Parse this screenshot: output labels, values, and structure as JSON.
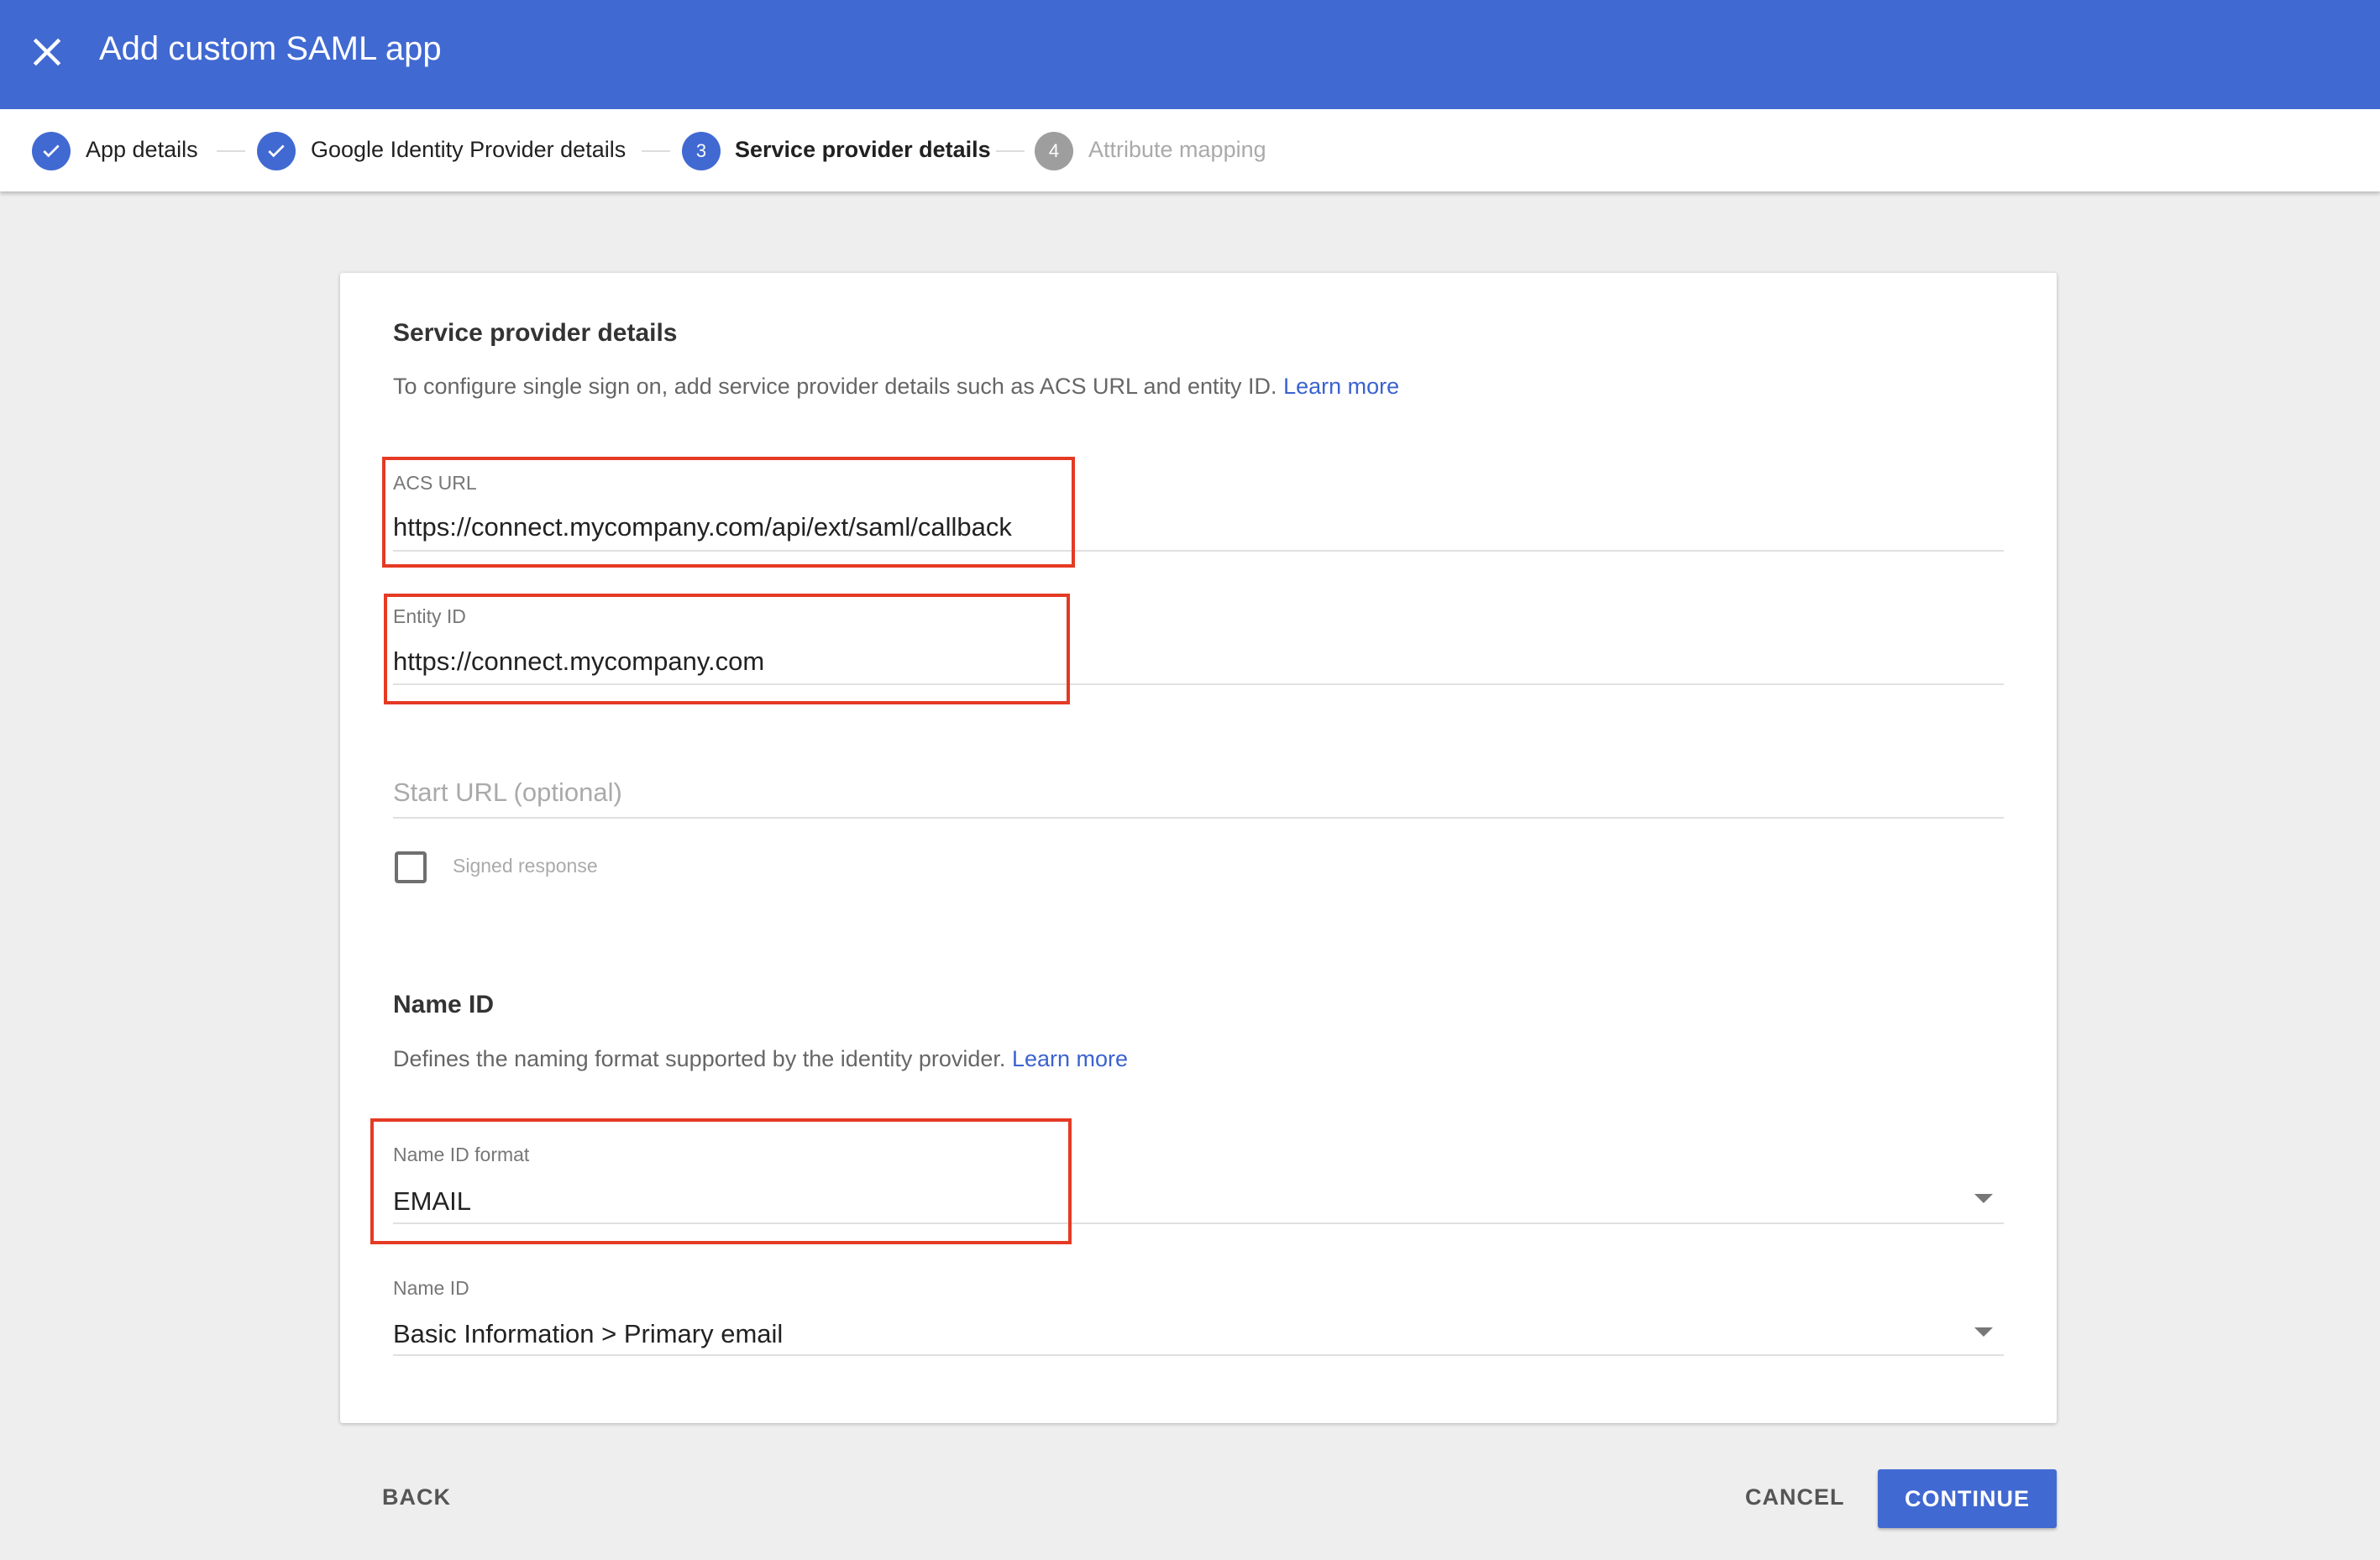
{
  "header": {
    "title": "Add custom SAML app"
  },
  "stepper": [
    {
      "label": "App details",
      "state": "done"
    },
    {
      "label": "Google Identity Provider details",
      "state": "done"
    },
    {
      "label": "Service provider details",
      "number": "3",
      "state": "active"
    },
    {
      "label": "Attribute mapping",
      "number": "4",
      "state": "pending"
    }
  ],
  "service": {
    "title": "Service provider details",
    "description": "To configure single sign on, add service provider details such as ACS URL and entity ID.",
    "learn_more": "Learn more",
    "acs_label": "ACS URL",
    "acs_value": "https://connect.mycompany.com/api/ext/saml/callback",
    "entity_label": "Entity ID",
    "entity_value": "https://connect.mycompany.com",
    "start_url_placeholder": "Start URL (optional)",
    "signed_response": "Signed response"
  },
  "nameid": {
    "title": "Name ID",
    "description": "Defines the naming format supported by the identity provider.",
    "learn_more": "Learn more",
    "format_label": "Name ID format",
    "format_value": "EMAIL",
    "id_label": "Name ID",
    "id_value": "Basic Information > Primary email"
  },
  "footer": {
    "back": "BACK",
    "cancel": "CANCEL",
    "continue": "CONTINUE"
  },
  "colors": {
    "brand": "#4169d2",
    "highlight": "#e53a24"
  }
}
